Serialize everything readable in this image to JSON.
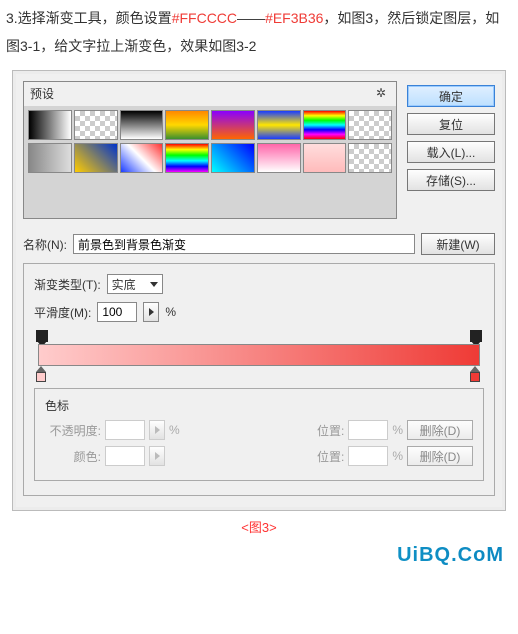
{
  "instruction": {
    "pre": "3.选择渐变工具，颜色设置",
    "color1": "#FFCCCC",
    "sep": "——",
    "color2": "#EF3B36",
    "post": "，如图3，然后锁定图层，如图3-1，给文字拉上渐变色，效果如图3-2"
  },
  "dialog": {
    "presets_label": "预设",
    "gear_icon": "✲",
    "buttons": {
      "ok": "确定",
      "reset": "复位",
      "load": "载入(L)...",
      "save": "存储(S)..."
    },
    "swatches": [
      "linear-gradient(90deg,#000,#fff)",
      "checker",
      "linear-gradient(180deg,#000,#fff)",
      "linear-gradient(180deg,#ff8800,#ffd800,#3b8f2f)",
      "linear-gradient(180deg,#8a00ff,#ff6600)",
      "linear-gradient(180deg,#1a3cff,#ffe600,#1a3cff)",
      "linear-gradient(180deg,#ff0000,#ffff00,#00ff00,#00ffff,#0000ff,#ff00ff,#ff0000)",
      "checker",
      "linear-gradient(90deg,#888,#ddd)",
      "linear-gradient(45deg,#ffcc00,#0033cc)",
      "linear-gradient(45deg,#1a3cff,#ffffff,#ff3333)",
      "linear-gradient(180deg,#ff0000,#ffff00,#00ff00,#00ffff,#0000ff,#ff00ff)",
      "linear-gradient(45deg,#00ffff,#0000ff)",
      "linear-gradient(180deg,#ff66aa,#ffffff)",
      "linear-gradient(180deg,#ffdddd,#ffbbbb)",
      "checker"
    ],
    "name_label": "名称(N):",
    "name_value": "前景色到背景色渐变",
    "new_button": "新建(W)",
    "type_label": "渐变类型(T):",
    "type_value": "实底",
    "smooth_label": "平滑度(M):",
    "smooth_value": "100",
    "smooth_unit": "%",
    "gradient": {
      "from": "#FFCCCC",
      "to": "#EF3B36"
    },
    "wells_label": "色标",
    "opacity_label": "不透明度:",
    "opacity_unit": "%",
    "location_label": "位置:",
    "location_unit": "%",
    "color_label": "颜色:",
    "delete_label": "删除(D)"
  },
  "caption": "<图3>",
  "watermark": "UiBQ.CoM"
}
